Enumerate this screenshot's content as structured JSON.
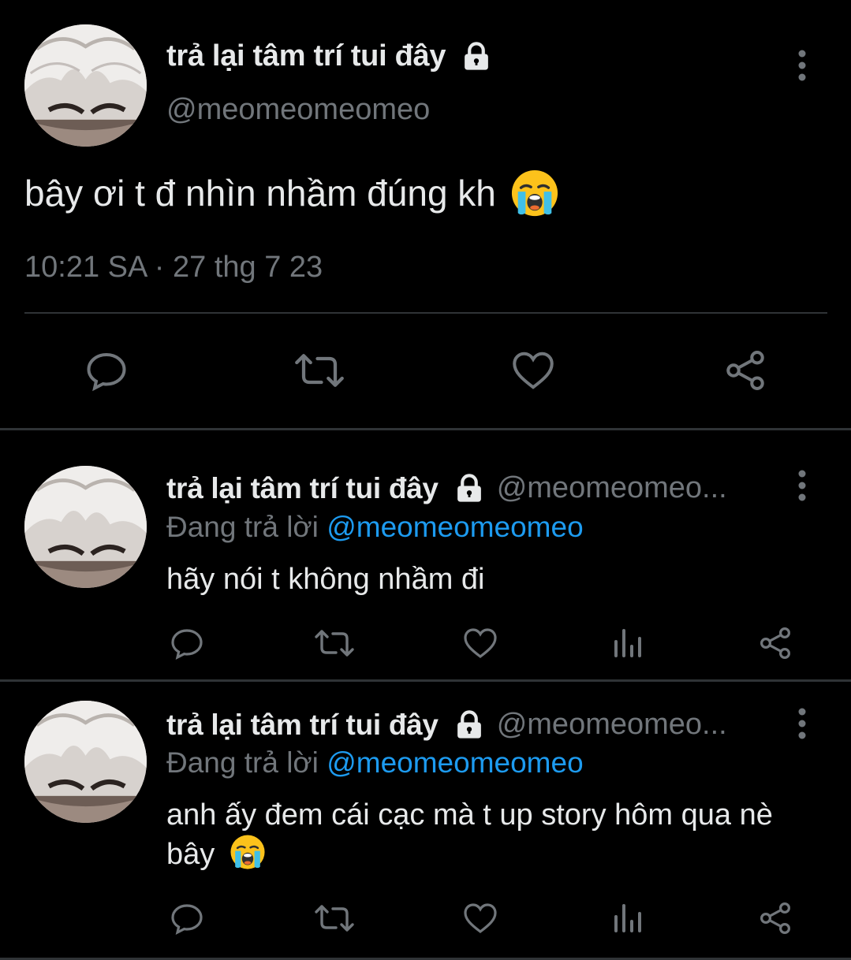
{
  "main_tweet": {
    "display_name": "trả lại tâm trí tui đây",
    "handle": "@meomeomeomeo",
    "text": "bây ơi t đ nhìn nhầm đúng kh",
    "emoji": "loudly-crying-face",
    "timestamp": "10:21 SA · 27 thg 7 23",
    "actions": [
      "reply-icon",
      "retweet-icon",
      "like-icon",
      "share-icon"
    ]
  },
  "replies": [
    {
      "display_name": "trả lại tâm trí tui đây",
      "handle": "@meomeomeo...",
      "replying_label": "Đang trả lời",
      "replying_to": "@meomeomeomeo",
      "text": "hãy nói t không nhầm đi",
      "has_emoji": false
    },
    {
      "display_name": "trả lại tâm trí tui đây",
      "handle": "@meomeomeo...",
      "replying_label": "Đang trả lời",
      "replying_to": "@meomeomeomeo",
      "text": "anh ấy đem cái cạc mà t up story hôm qua nè bây",
      "has_emoji": true,
      "emoji": "loudly-crying-face"
    }
  ],
  "colors": {
    "background": "#000000",
    "text_primary": "#e7e9ea",
    "text_secondary": "#71767b",
    "accent": "#1d9bf0",
    "divider": "#2f3336"
  }
}
